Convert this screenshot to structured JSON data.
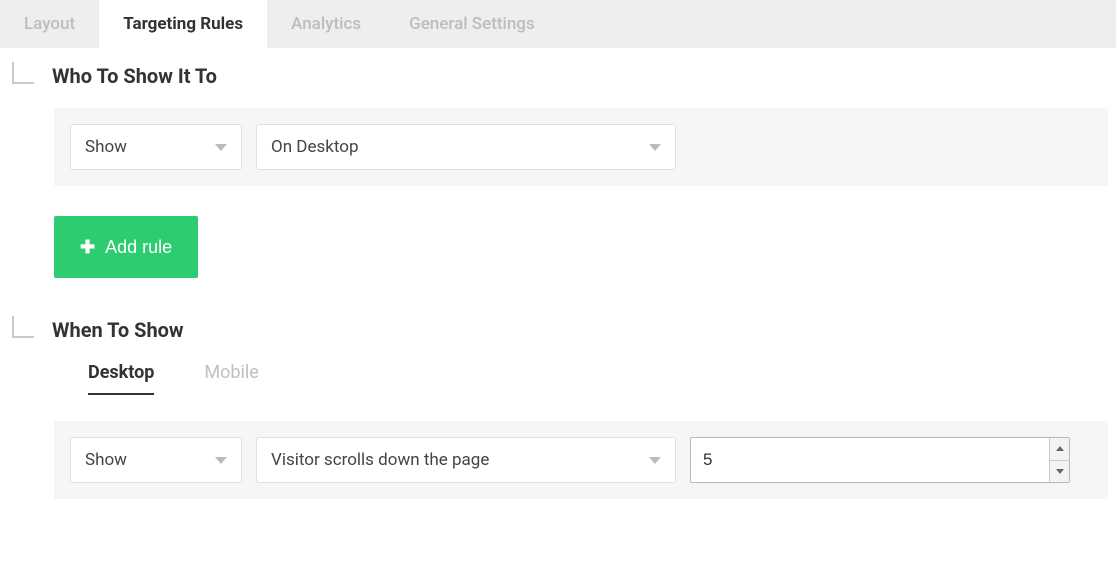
{
  "tabs": {
    "layout": "Layout",
    "targeting": "Targeting Rules",
    "analytics": "Analytics",
    "settings": "General Settings"
  },
  "sections": {
    "who": {
      "title": "Who To Show It To",
      "action": "Show",
      "condition": "On Desktop",
      "add_rule_label": "Add rule"
    },
    "when": {
      "title": "When To Show",
      "subtabs": {
        "desktop": "Desktop",
        "mobile": "Mobile"
      },
      "action": "Show",
      "condition": "Visitor scrolls down the page",
      "value": "5"
    }
  }
}
